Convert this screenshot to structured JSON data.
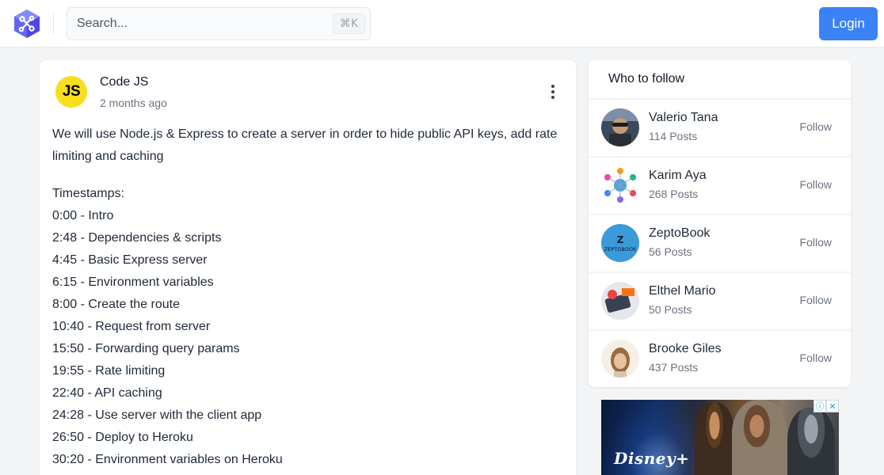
{
  "header": {
    "search_placeholder": "Search...",
    "search_shortcut": "⌘K",
    "login_label": "Login",
    "accent_color": "#3b82f6"
  },
  "post": {
    "author": "Code JS",
    "avatar_text": "JS",
    "time": "2 months ago",
    "intro": "We will use Node.js & Express to create a server in order to hide public API keys, add rate limiting and caching",
    "timestamps_heading": "Timestamps:",
    "timestamps": [
      "0:00 - Intro",
      "2:48 - Dependencies & scripts",
      "4:45 - Basic Express server",
      "6:15 - Environment variables",
      "8:00 - Create the route",
      "10:40 - Request from server",
      "15:50 - Forwarding query params",
      "19:55 - Rate limiting",
      "22:40 - API caching",
      "24:28 - Use server with the client app",
      "26:50 - Deploy to Heroku",
      "30:20 - Environment variables on Heroku"
    ]
  },
  "who_to_follow": {
    "title": "Who to follow",
    "follow_label": "Follow",
    "users": [
      {
        "name": "Valerio Tana",
        "posts": "114 Posts"
      },
      {
        "name": "Karim Aya",
        "posts": "268 Posts"
      },
      {
        "name": "ZeptoBook",
        "posts": "56 Posts"
      },
      {
        "name": "Elthel Mario",
        "posts": "50 Posts"
      },
      {
        "name": "Brooke Giles",
        "posts": "437 Posts"
      }
    ]
  },
  "ad": {
    "brand": "Disney+",
    "info_icon": "ⓘ",
    "close_icon": "✕"
  }
}
